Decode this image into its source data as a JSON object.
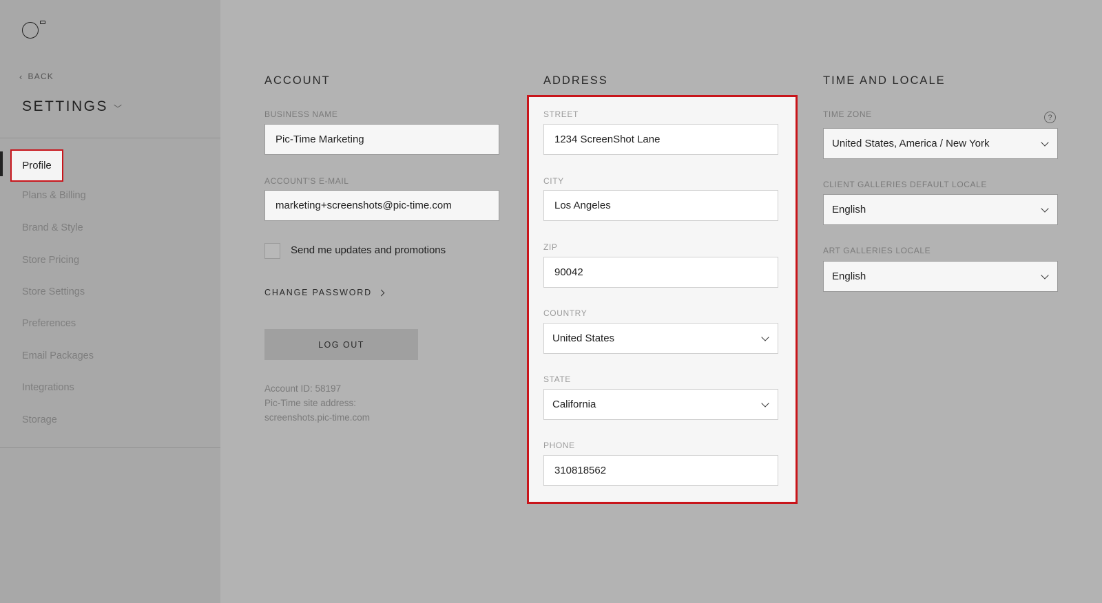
{
  "sidebar": {
    "back_label": "BACK",
    "title": "SETTINGS",
    "items": [
      {
        "label": "Profile",
        "active": true
      },
      {
        "label": "Plans & Billing"
      },
      {
        "label": "Brand & Style"
      },
      {
        "label": "Store Pricing"
      },
      {
        "label": "Store Settings"
      },
      {
        "label": "Preferences"
      },
      {
        "label": "Email Packages"
      },
      {
        "label": "Integrations"
      },
      {
        "label": "Storage"
      }
    ]
  },
  "account": {
    "title": "ACCOUNT",
    "business_name_label": "BUSINESS NAME",
    "business_name": "Pic-Time Marketing",
    "email_label": "ACCOUNT'S E-MAIL",
    "email": "marketing+screenshots@pic-time.com",
    "updates_label": "Send me updates and promotions",
    "updates_checked": false,
    "change_password_label": "CHANGE PASSWORD",
    "logout_label": "LOG OUT",
    "account_id": "Account ID: 58197",
    "site_address_label": "Pic-Time site address:",
    "site_address": "screenshots.pic-time.com"
  },
  "address": {
    "title": "ADDRESS",
    "street_label": "STREET",
    "street": "1234 ScreenShot Lane",
    "city_label": "CITY",
    "city": "Los Angeles",
    "zip_label": "ZIP",
    "zip": "90042",
    "country_label": "COUNTRY",
    "country": "United States",
    "state_label": "STATE",
    "state": "California",
    "phone_label": "PHONE",
    "phone": "310818562"
  },
  "time_locale": {
    "title": "TIME AND LOCALE",
    "time_zone_label": "TIME ZONE",
    "time_zone": "United States, America / New York",
    "help_icon": "?",
    "client_locale_label": "CLIENT GALLERIES DEFAULT LOCALE",
    "client_locale": "English",
    "art_locale_label": "ART GALLERIES LOCALE",
    "art_locale": "English"
  },
  "colors": {
    "highlight": "#c8151b",
    "overlay": "#b3b3b3",
    "sidebar": "#a8a8a8"
  }
}
